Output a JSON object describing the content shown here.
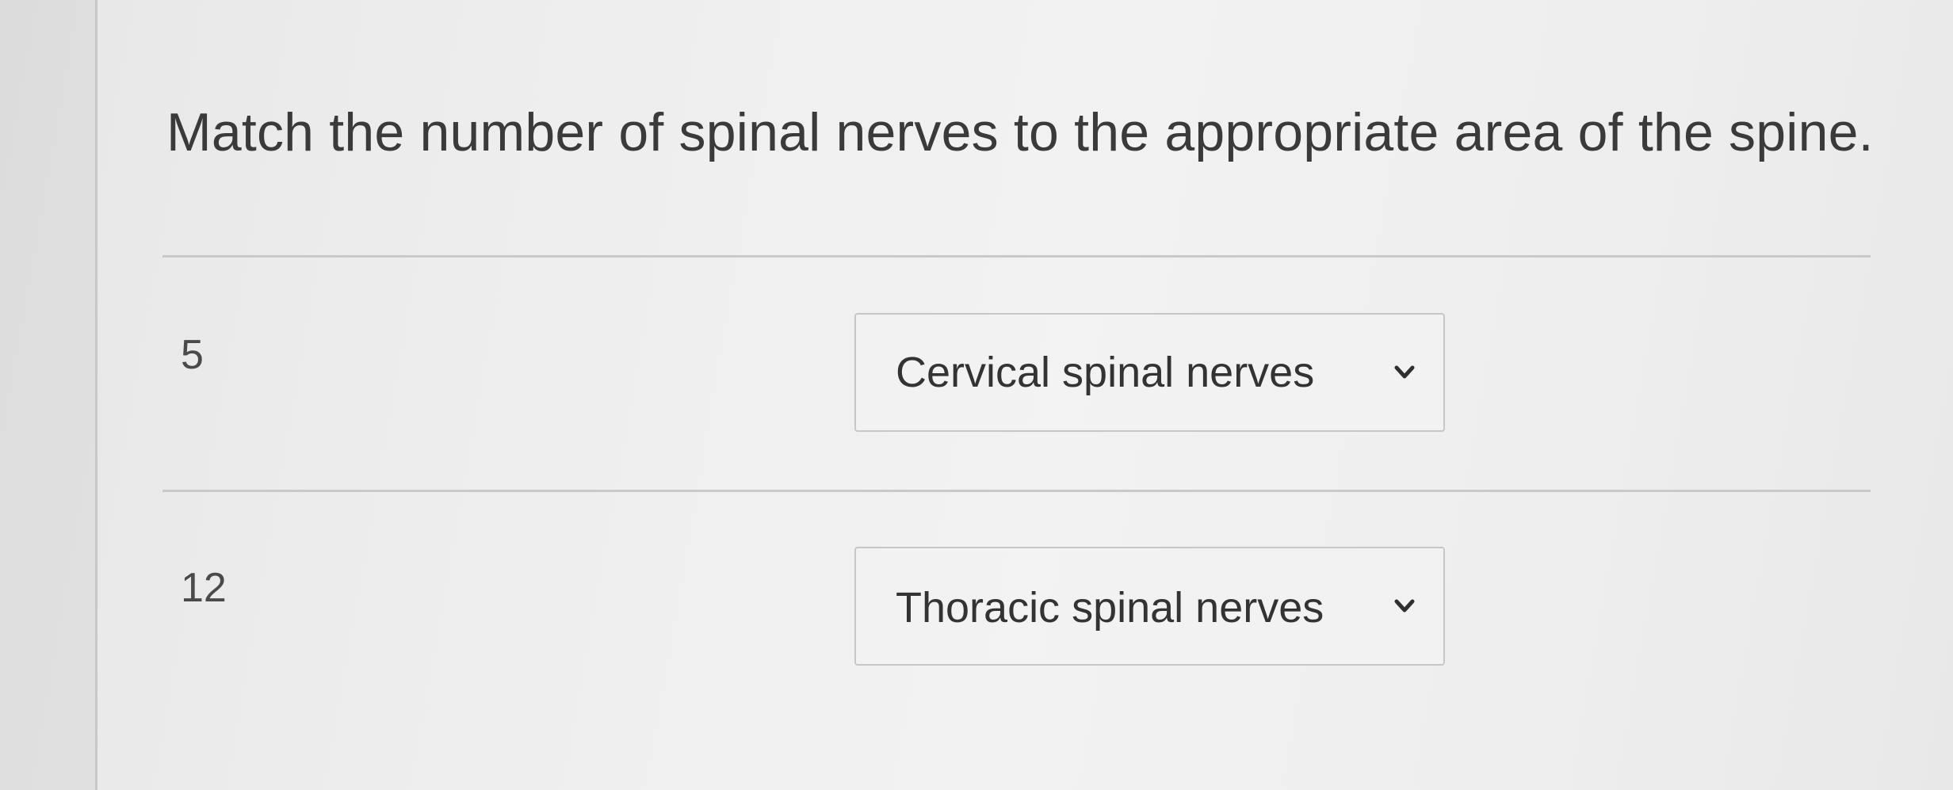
{
  "question": {
    "prompt": "Match the number of spinal nerves to the appropriate area of the spine."
  },
  "rows": [
    {
      "number": "5",
      "selected": "Cervical spinal nerves"
    },
    {
      "number": "12",
      "selected": "Thoracic spinal nerves"
    }
  ],
  "icons": {
    "dropdown": "chevron-down-icon"
  },
  "colors": {
    "text": "#3a3a3a",
    "border": "#c7c7c7"
  }
}
